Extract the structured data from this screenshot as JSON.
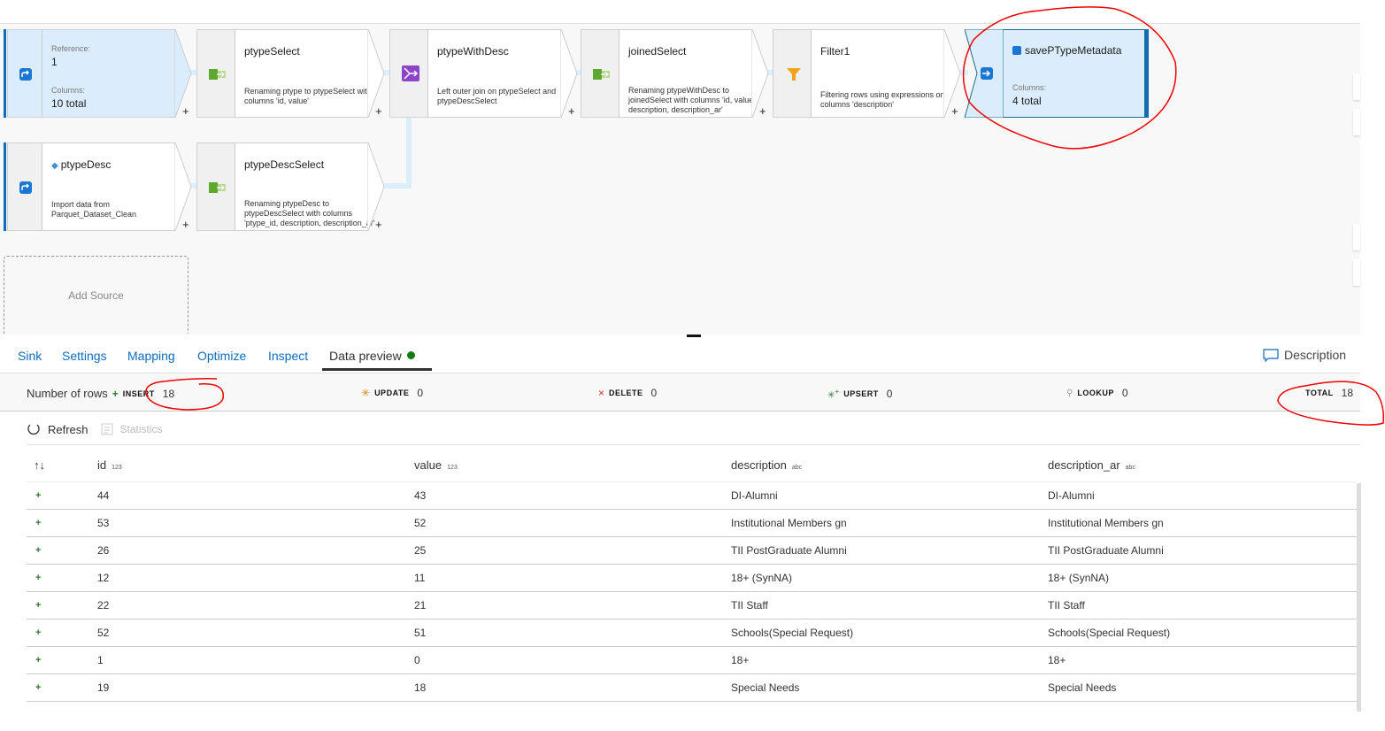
{
  "pipeline": {
    "nodes": [
      {
        "id": "ref",
        "label_ref": "Reference:",
        "ref_value": "1",
        "label_cols": "Columns:",
        "cols_value": "10 total"
      },
      {
        "id": "ptypeSelect",
        "title": "ptypeSelect",
        "desc": "Renaming ptype to ptypeSelect with columns 'id, value'"
      },
      {
        "id": "ptypeWithDesc",
        "title": "ptypeWithDesc",
        "desc": "Left outer join on ptypeSelect and ptypeDescSelect"
      },
      {
        "id": "joinedSelect",
        "title": "joinedSelect",
        "desc": "Renaming ptypeWithDesc to joinedSelect with columns 'id, value, description, description_ar'"
      },
      {
        "id": "Filter1",
        "title": "Filter1",
        "desc": "Filtering rows using expressions on columns 'description'"
      },
      {
        "id": "sink",
        "title": "savePTypeMetadata",
        "label_cols": "Columns:",
        "cols_value": "4 total"
      },
      {
        "id": "ptypeDesc",
        "title": "ptypeDesc",
        "desc": "Import data from Parquet_Dataset_Clean"
      },
      {
        "id": "ptypeDescSelect",
        "title": "ptypeDescSelect",
        "desc": "Renaming ptypeDesc to ptypeDescSelect with columns 'ptype_id, description, description_ar'"
      }
    ],
    "add_source": "Add Source",
    "plus": "+"
  },
  "tabs": [
    {
      "label": "Sink"
    },
    {
      "label": "Settings"
    },
    {
      "label": "Mapping"
    },
    {
      "label": "Optimize"
    },
    {
      "label": "Inspect"
    },
    {
      "label": "Data preview"
    }
  ],
  "description_button": "Description",
  "stats": {
    "label": "Number of rows",
    "insert": {
      "key": "INSERT",
      "value": "18"
    },
    "update": {
      "key": "UPDATE",
      "value": "0"
    },
    "delete": {
      "key": "DELETE",
      "value": "0"
    },
    "upsert": {
      "key": "UPSERT",
      "value": "0"
    },
    "lookup": {
      "key": "LOOKUP",
      "value": "0"
    },
    "total": {
      "key": "TOTAL",
      "value": "18"
    }
  },
  "toolbar": {
    "refresh": "Refresh",
    "statistics": "Statistics"
  },
  "table": {
    "sort_icon": "↑↓",
    "columns": [
      {
        "name": "id",
        "type": "123"
      },
      {
        "name": "value",
        "type": "123"
      },
      {
        "name": "description",
        "type": "abc"
      },
      {
        "name": "description_ar",
        "type": "abc"
      }
    ],
    "rows": [
      [
        "44",
        "43",
        "DI-Alumni",
        "DI-Alumni"
      ],
      [
        "53",
        "52",
        "Institutional Members gn",
        "Institutional Members gn"
      ],
      [
        "26",
        "25",
        "TII PostGraduate Alumni",
        "TII PostGraduate Alumni"
      ],
      [
        "12",
        "11",
        "18+ (SynNA)",
        "18+ (SynNA)"
      ],
      [
        "22",
        "21",
        "TII Staff",
        "TII Staff"
      ],
      [
        "52",
        "51",
        "Schools(Special Request)",
        "Schools(Special Request)"
      ],
      [
        "1",
        "0",
        "18+",
        "18+"
      ],
      [
        "19",
        "18",
        "Special Needs",
        "Special Needs"
      ]
    ],
    "row_marker": "+"
  }
}
